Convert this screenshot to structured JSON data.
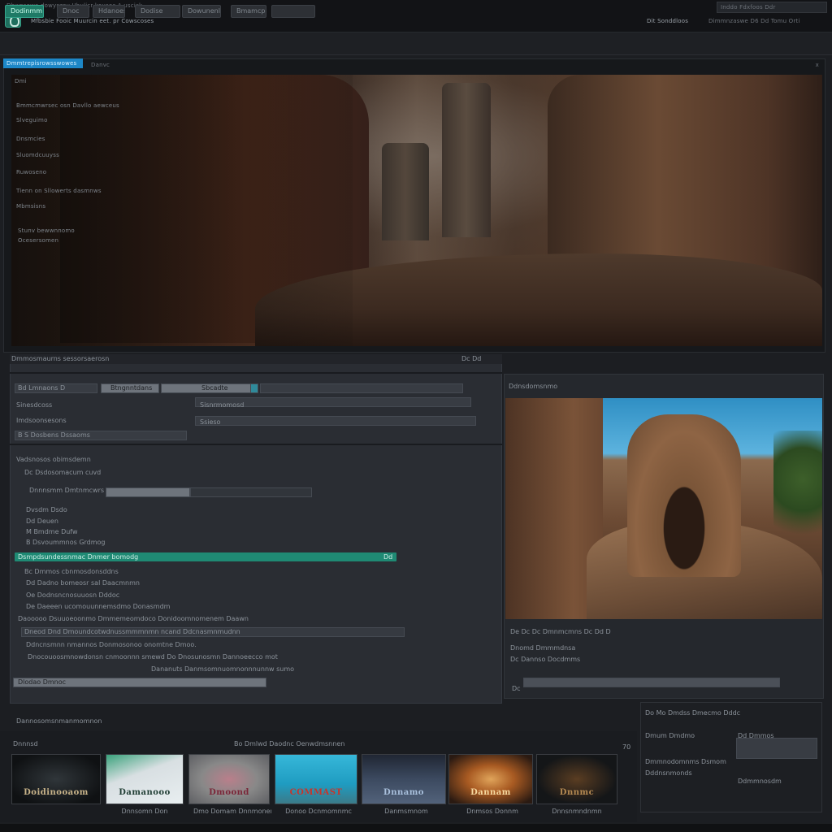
{
  "titlebar": {
    "top_text": "Dbwnsowe dowyszoy Hbulicr kousec A uscick",
    "subtitle": "Mfbsbie Fooic Muurcin eet. pr Cowscoses",
    "info": "Dit Sonddloos",
    "controls": "Inddo Fdxfoos Ddr",
    "controls2": "Dimmnzaswe D6 Dd Tomu Orti"
  },
  "toolbar": {
    "buttons": [
      "Dodinmm",
      "Dnoc",
      "Hdanoes",
      "Dodise",
      "Dowunenl",
      "Bmamcpo"
    ]
  },
  "main_panel": {
    "tab_label": "Dmmtrepisrowsswowes",
    "tab_sublabel": "Danvc",
    "close_label": "x",
    "overlay_items": [
      "Dmi",
      "Bmmcmwrsec osn Davllo aewceus",
      "Slveguimo",
      "Dnsmcies",
      "Sluomdcuuyss",
      "Ruwoseno",
      "Tienn on Sllowerts dasmnws",
      "Mbmsisns",
      "Stunv bewwnnomo",
      "Ocesersomen"
    ]
  },
  "properties": {
    "header": "Dmmosmaurns sessorsaerosn",
    "header_right": "Dc Dd",
    "field_row_1_label": "Bd Lmnaons D",
    "field_row_1_value": "Btngnntdans",
    "field_row_1_right": "Sbcadte",
    "field_row_2_label": "Sinesdcoss",
    "field_row_2_value": "Sisnrmomosd",
    "field_row_3_label": "Imdsoonsesons",
    "field_row_3_value": "Ssieso",
    "field_row_4_label": "B S Dosbens Dssaoms",
    "tree_items": [
      "Vadsnosos obimsdemn",
      "Dc Dsdosomacum cuvd",
      "Dnnnsmm Dmtnmcwrs",
      "Dvsdm Dsdo",
      "Dd Deuen",
      "M Bmdme Dufw",
      "B Dsvoummnos Grdmog"
    ],
    "selected_item": "Dsmpdsundessnmac Dnmer bomodg",
    "selected_right": "Dd",
    "list_items": [
      "Bc Dmmos cbnmosdonsddns",
      "Dd Dadno bomeosr sal Daacmnmn",
      "Oe Dodnsncnosuuosn Dddoc",
      "De Daeeen ucomouunnemsdmo Donasmdm",
      "Daooooo Dsuuoeoonmo Dmmemeomdoco Donidoomnomenem Daawn",
      "Dneod Dnd Dmoundcotwdnussmmmnmn ncand Ddcnasmnmudnn",
      "Ddncnsmnn nmannos Donmosonoo onomtne Dmoo.",
      "Dnocouoosmnowdonsn cnmoonnn smewd Do Dnosunosmn Dannoeecco mot",
      "Dananuts Danmsomnuomnonnnunnw sumo",
      "Dlodao Dmnoc"
    ],
    "footer": "Dannosomsnmanmomnon"
  },
  "preview": {
    "title": "Ddnsdomsnmo",
    "coords_label": "De Dc Dc Dmnmcmns Dc Dd D",
    "row_1": "Dnomd Dmmmdnsa",
    "row_2": "Dc Dannso Docdmms",
    "row_3": "Dc"
  },
  "details": {
    "rows": [
      "Do Mo Dmdss Dmecmo Dddc",
      "Dmum Dmdmo",
      "Dd Dmmos",
      "Dmmnodomnms Dsmomod",
      "Dddnsnmonds",
      "Ddmmnosdm"
    ]
  },
  "media_strip": {
    "label": "Dnnnsd",
    "search_text": "Bo Dmlwd Daodnc Oenwdmsnnen",
    "count": "70",
    "thumbnails": [
      {
        "title": "Doidinooaom",
        "caption": "Dnnsomn Don"
      },
      {
        "title": "Damanooo",
        "caption": "Dmo Domam Dnnmonemus"
      },
      {
        "title": "Dmoond",
        "caption": "Donoo Dcnmomnmc"
      },
      {
        "title": "COMMAST",
        "caption": "Danmsmnom"
      },
      {
        "title": "Dnnamo",
        "caption": "Dnmsos Donnm"
      },
      {
        "title": "Dannam",
        "caption": "Dnnsnmndnmn"
      },
      {
        "title": "Dnnmc",
        "caption": ""
      }
    ]
  },
  "colors": {
    "accent_teal": "#1f8a74",
    "accent_blue": "#1d87c7",
    "background": "#1c1e22"
  }
}
